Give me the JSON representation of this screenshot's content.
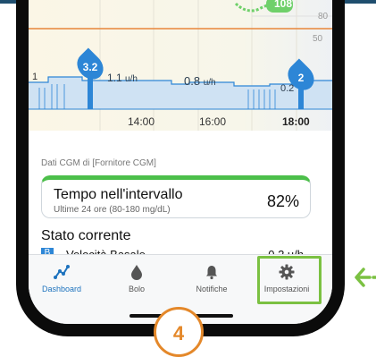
{
  "chart": {
    "cgm_peak_value": "108",
    "y_ticks": [
      "80",
      "50"
    ],
    "x_ticks": [
      "14:00",
      "16:00",
      "18:00"
    ],
    "bolus_markers": [
      "3.2",
      "2"
    ],
    "rate_labels": [
      {
        "value": "1.1",
        "unit": "u/h"
      },
      {
        "value": "0.8",
        "unit": "u/h"
      },
      {
        "value": "0.2",
        "unit": ""
      }
    ],
    "left_edge_label": "1",
    "colors": {
      "basal": "#2d86d6",
      "cgm": "#6fd06a",
      "target_line": "#e8863a"
    }
  },
  "source_line": "Dati CGM di [Fornitore CGM]",
  "time_in_range": {
    "title": "Tempo nell'intervallo",
    "subtitle": "Ultime 24 ore (80-180 mg/dL)",
    "value": "82%",
    "accent_color": "#4cbf4a"
  },
  "current_status": {
    "title": "Stato corrente",
    "partial_row_label": "Velocità Basale",
    "partial_row_value": "0.2 u/h"
  },
  "tabs": [
    {
      "label": "Dashboard",
      "icon": "chart-line-icon",
      "active": true
    },
    {
      "label": "Bolo",
      "icon": "drop-icon",
      "active": false
    },
    {
      "label": "Notifiche",
      "icon": "bell-icon",
      "active": false
    },
    {
      "label": "Impostazioni",
      "icon": "gear-icon",
      "active": false
    }
  ],
  "annotation": {
    "step_number": "4",
    "highlight_color": "#7bc142",
    "step_color": "#e4882a"
  }
}
